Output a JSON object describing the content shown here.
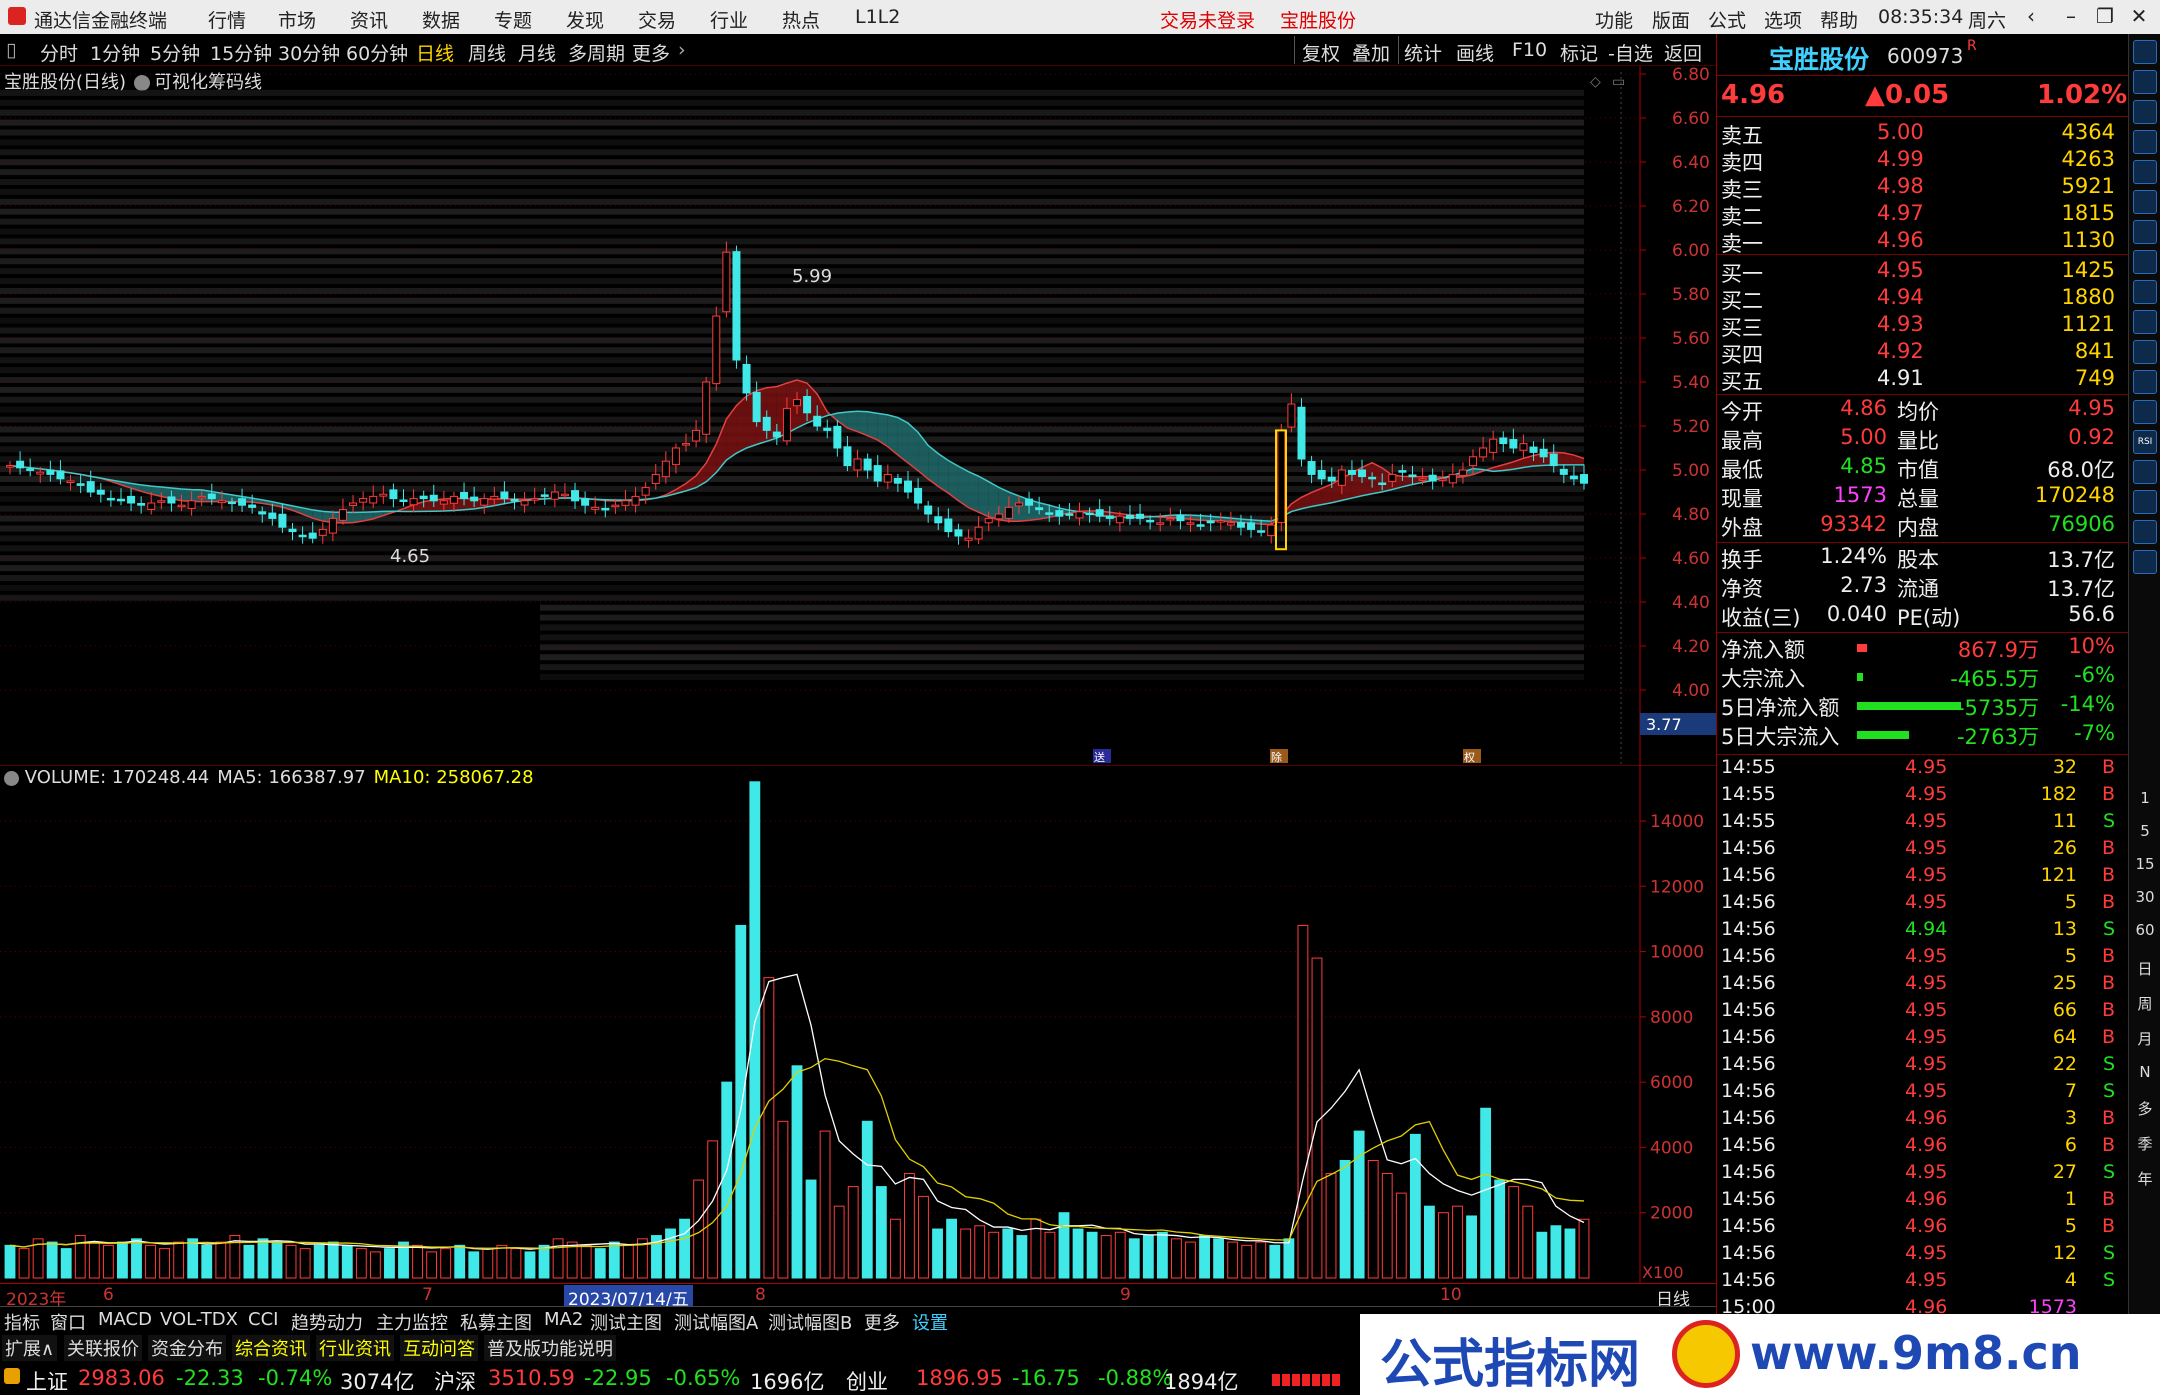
{
  "app": {
    "title": "通达信金融终端"
  },
  "menu": [
    "行情",
    "市场",
    "资讯",
    "数据",
    "专题",
    "发现",
    "交易",
    "行业",
    "热点",
    "L1L2"
  ],
  "alerts": [
    "交易未登录",
    "宝胜股份"
  ],
  "right_menu": [
    "功能",
    "版面",
    "公式",
    "选项",
    "帮助"
  ],
  "clock": "08:35:34",
  "weekday": "周六",
  "periods": [
    "分时",
    "1分钟",
    "5分钟",
    "15分钟",
    "30分钟",
    "60分钟",
    "日线",
    "周线",
    "月线",
    "多周期",
    "更多"
  ],
  "selected_period": "日线",
  "tools": [
    "复权",
    "叠加",
    "统计",
    "画线",
    "F10",
    "标记",
    "-自选",
    "返回"
  ],
  "chart": {
    "title": "宝胜股份(日线)",
    "indicator": "可视化筹码线",
    "price_scale": [
      "6.80",
      "6.60",
      "6.40",
      "6.20",
      "6.00",
      "5.80",
      "5.60",
      "5.40",
      "5.20",
      "5.00",
      "4.80",
      "4.60",
      "4.40",
      "4.20",
      "4.00"
    ],
    "low_mark": "3.77",
    "high_label": "5.99",
    "low_label": "4.65",
    "events": [
      "送",
      "除",
      "权"
    ]
  },
  "volume": {
    "label": "VOLUME: 170248.44",
    "ma5": "MA5: 166387.97",
    "ma10": "MA10: 258067.28",
    "scale": [
      "14000",
      "12000",
      "10000",
      "8000",
      "6000",
      "4000",
      "2000"
    ],
    "unit": "X100"
  },
  "dates": {
    "year": "2023年",
    "m6": "6",
    "m7": "7",
    "cursor": "2023/07/14/五",
    "m8": "8",
    "m9": "9",
    "m10": "10",
    "period": "日线"
  },
  "tabs1": [
    "指标",
    "窗口",
    "MACD",
    "VOL-TDX",
    "CCI",
    "趋势动力",
    "主力监控",
    "私募主图",
    "MA2",
    "测试主图",
    "测试幅图A",
    "测试幅图B",
    "更多",
    "设置"
  ],
  "tabs2": [
    "扩展∧",
    "关联报价",
    "资金分布",
    "综合资讯",
    "行业资讯",
    "互动问答",
    "普及版功能说明"
  ],
  "index_bar": [
    {
      "name": "上证",
      "value": "2983.06",
      "chg": "-22.33",
      "pct": "-0.74%",
      "amt": "3074亿"
    },
    {
      "name": "沪深",
      "value": "3510.59",
      "chg": "-22.95",
      "pct": "-0.65%",
      "amt": "1696亿"
    },
    {
      "name": "创业",
      "value": "1896.95",
      "chg": "-16.75",
      "pct": "-0.88%",
      "amt": "1894亿"
    }
  ],
  "quote": {
    "name": "宝胜股份",
    "code": "600973",
    "flag": "R",
    "price": "4.96",
    "change": "▲0.05",
    "pct": "1.02%"
  },
  "orderbook": {
    "sell": [
      {
        "l": "卖五",
        "p": "5.00",
        "v": "4364"
      },
      {
        "l": "卖四",
        "p": "4.99",
        "v": "4263"
      },
      {
        "l": "卖三",
        "p": "4.98",
        "v": "5921"
      },
      {
        "l": "卖二",
        "p": "4.97",
        "v": "1815"
      },
      {
        "l": "卖一",
        "p": "4.96",
        "v": "1130"
      }
    ],
    "buy": [
      {
        "l": "买一",
        "p": "4.95",
        "v": "1425"
      },
      {
        "l": "买二",
        "p": "4.94",
        "v": "1880"
      },
      {
        "l": "买三",
        "p": "4.93",
        "v": "1121"
      },
      {
        "l": "买四",
        "p": "4.92",
        "v": "841"
      },
      {
        "l": "买五",
        "p": "4.91",
        "v": "749"
      }
    ]
  },
  "stats": [
    {
      "a": "今开",
      "b": "4.86",
      "c": "均价",
      "d": "4.95"
    },
    {
      "a": "最高",
      "b": "5.00",
      "c": "量比",
      "d": "0.92"
    },
    {
      "a": "最低",
      "b": "4.85",
      "c": "市值",
      "d": "68.0亿"
    },
    {
      "a": "现量",
      "b": "1573",
      "c": "总量",
      "d": "170248"
    },
    {
      "a": "外盘",
      "b": "93342",
      "c": "内盘",
      "d": "76906"
    }
  ],
  "stats2": [
    {
      "a": "换手",
      "b": "1.24%",
      "c": "股本",
      "d": "13.7亿"
    },
    {
      "a": "净资",
      "b": "2.73",
      "c": "流通",
      "d": "13.7亿"
    },
    {
      "a": "收益(三)",
      "b": "0.040",
      "c": "PE(动)",
      "d": "56.6"
    }
  ],
  "flows": [
    {
      "l": "净流入额",
      "v": "867.9万",
      "p": "10%",
      "bar": 0.1
    },
    {
      "l": "大宗流入",
      "v": "-465.5万",
      "p": "-6%",
      "bar": 0.06
    },
    {
      "l": "5日净流入额",
      "v": "-5735万",
      "p": "-14%",
      "bar": 1.0
    },
    {
      "l": "5日大宗流入",
      "v": "-2763万",
      "p": "-7%",
      "bar": 0.5
    }
  ],
  "ticks": [
    [
      "14:55",
      "4.95",
      "32",
      "B"
    ],
    [
      "14:55",
      "4.95",
      "182",
      "B"
    ],
    [
      "14:55",
      "4.95",
      "11",
      "S"
    ],
    [
      "14:56",
      "4.95",
      "26",
      "B"
    ],
    [
      "14:56",
      "4.95",
      "121",
      "B"
    ],
    [
      "14:56",
      "4.95",
      "5",
      "B"
    ],
    [
      "14:56",
      "4.94",
      "13",
      "S"
    ],
    [
      "14:56",
      "4.95",
      "5",
      "B"
    ],
    [
      "14:56",
      "4.95",
      "25",
      "B"
    ],
    [
      "14:56",
      "4.95",
      "66",
      "B"
    ],
    [
      "14:56",
      "4.95",
      "64",
      "B"
    ],
    [
      "14:56",
      "4.95",
      "22",
      "S"
    ],
    [
      "14:56",
      "4.95",
      "7",
      "S"
    ],
    [
      "14:56",
      "4.96",
      "3",
      "B"
    ],
    [
      "14:56",
      "4.96",
      "6",
      "B"
    ],
    [
      "14:56",
      "4.95",
      "27",
      "S"
    ],
    [
      "14:56",
      "4.96",
      "1",
      "B"
    ],
    [
      "14:56",
      "4.96",
      "5",
      "B"
    ],
    [
      "14:56",
      "4.95",
      "12",
      "S"
    ],
    [
      "14:56",
      "4.95",
      "4",
      "S"
    ],
    [
      "15:00",
      "4.96",
      "1573",
      ""
    ]
  ],
  "sidebar": [
    "1",
    "5",
    "15",
    "30",
    "60",
    "日",
    "周",
    "月",
    "N",
    "多",
    "季",
    "年"
  ],
  "sidebar_icons": [
    "RSI"
  ],
  "watermark": {
    "left": "公式指标网",
    "right": "www.9m8.cn"
  }
}
